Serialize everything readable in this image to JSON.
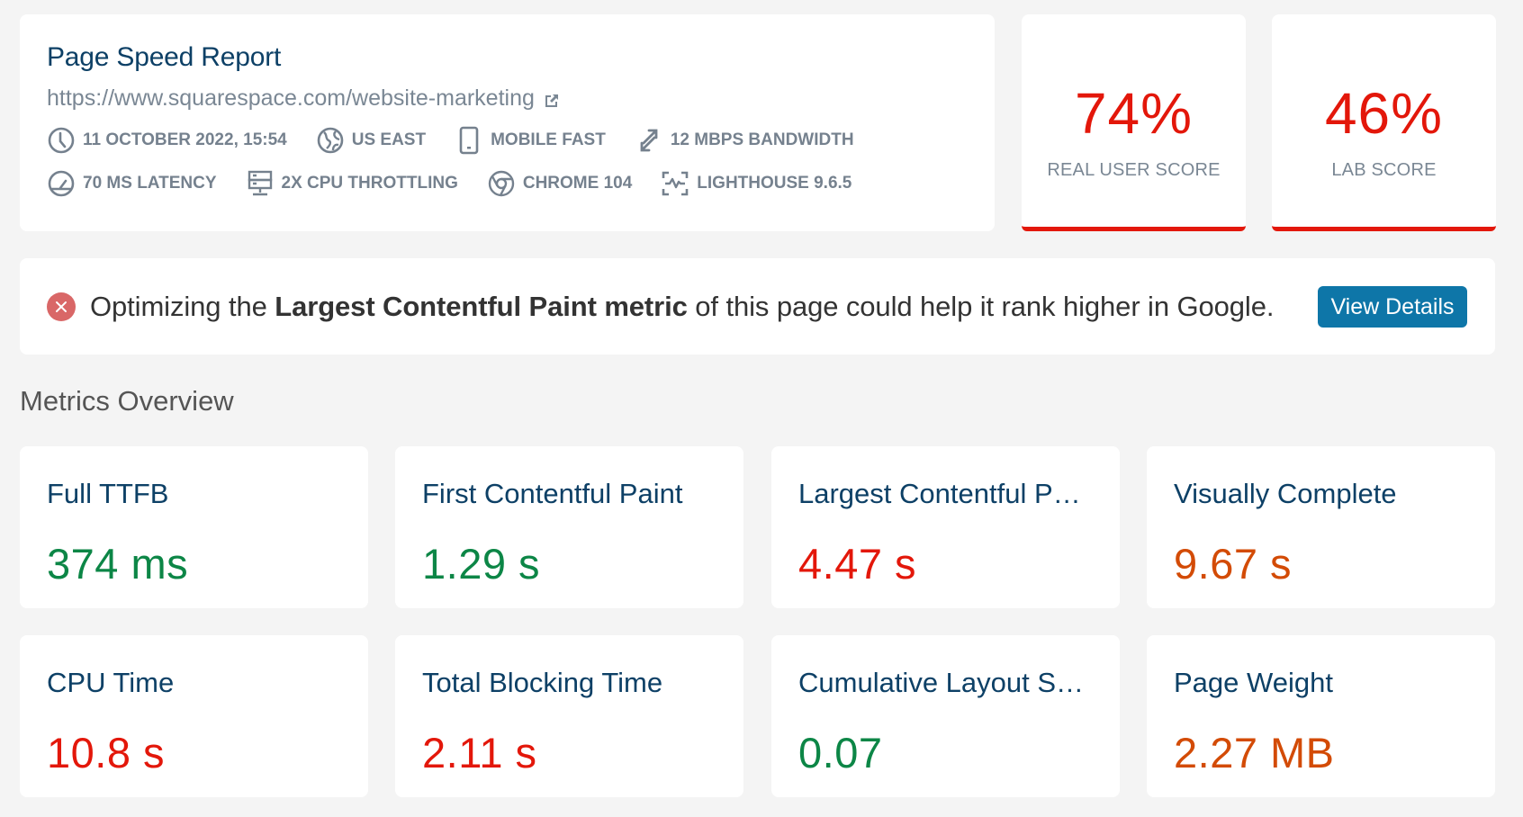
{
  "header": {
    "title": "Page Speed Report",
    "url": "https://www.squarespace.com/website-marketing",
    "meta_row_1": [
      {
        "icon": "clock-icon",
        "label": "11 October 2022, 15:54"
      },
      {
        "icon": "globe-icon",
        "label": "US East"
      },
      {
        "icon": "mobile-device-icon",
        "label": "Mobile Fast"
      },
      {
        "icon": "bandwidth-arrows-icon",
        "label": "12 Mbps Bandwidth"
      }
    ],
    "meta_row_2": [
      {
        "icon": "latency-gauge-icon",
        "label": "70 ms Latency"
      },
      {
        "icon": "cpu-server-icon",
        "label": "2x CPU Throttling"
      },
      {
        "icon": "chrome-icon",
        "label": "Chrome 104"
      },
      {
        "icon": "lighthouse-pulse-icon",
        "label": "Lighthouse 9.6.5"
      }
    ]
  },
  "scores": {
    "real_user": {
      "value": "74%",
      "label": "Real User Score"
    },
    "lab": {
      "value": "46%",
      "label": "Lab Score"
    }
  },
  "alert": {
    "icon": "error-x-icon",
    "text_before": "Optimizing the ",
    "text_bold": "Largest Contentful Paint metric",
    "text_after": " of this page could help it rank higher in Google.",
    "button_label": "View Details"
  },
  "metrics_overview": {
    "title": "Metrics Overview",
    "cards": [
      {
        "title": "Full TTFB",
        "value": "374 ms",
        "status": "good"
      },
      {
        "title": "First Contentful Paint",
        "value": "1.29 s",
        "status": "good"
      },
      {
        "title": "Largest Contentful Paint",
        "value": "4.47 s",
        "status": "poor"
      },
      {
        "title": "Visually Complete",
        "value": "9.67 s",
        "status": "ni"
      },
      {
        "title": "CPU Time",
        "value": "10.8 s",
        "status": "poor"
      },
      {
        "title": "Total Blocking Time",
        "value": "2.11 s",
        "status": "poor"
      },
      {
        "title": "Cumulative Layout Shift",
        "value": "0.07",
        "status": "good"
      },
      {
        "title": "Page Weight",
        "value": "2.27 MB",
        "status": "ni"
      }
    ]
  },
  "colors": {
    "good": "#0c8646",
    "poor": "#e3170a",
    "needs_improvement": "#d34b06",
    "primary_button": "#0e76a8",
    "title": "#0d4066"
  }
}
